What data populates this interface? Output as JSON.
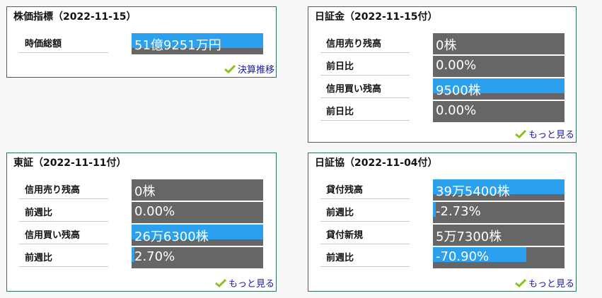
{
  "panels": [
    {
      "title": "株価指標（2022-11-15）",
      "link": "決算推移",
      "rows": [
        {
          "label": "時価総額",
          "value": "51億9251万円",
          "bar": 1.0
        }
      ]
    },
    {
      "title": "日証金（2022-11-15付）",
      "link": "もっと見る",
      "rows": [
        {
          "label": "信用売り残高",
          "value": "0株",
          "bar": 0
        },
        {
          "label": "前日比",
          "value": "0.00%",
          "bar": 0
        },
        {
          "label": "信用買い残高",
          "value": "9500株",
          "bar": 1.0
        },
        {
          "label": "前日比",
          "value": "0.00%",
          "bar": 0
        }
      ]
    },
    {
      "title": "東証（2022-11-11付）",
      "link": "もっと見る",
      "rows": [
        {
          "label": "信用売り残高",
          "value": "0株",
          "bar": 0
        },
        {
          "label": "前週比",
          "value": "0.00%",
          "bar": 0
        },
        {
          "label": "信用買い残高",
          "value": "26万6300株",
          "bar": 1.0
        },
        {
          "label": "前週比",
          "value": "2.70%",
          "bar": 0.027
        }
      ]
    },
    {
      "title": "日証協（2022-11-04付）",
      "link": "もっと見る",
      "rows": [
        {
          "label": "貸付残高",
          "value": "39万5400株",
          "bar": 1.0
        },
        {
          "label": "前週比",
          "value": "-2.73%",
          "bar": 0.0273
        },
        {
          "label": "貸付新規",
          "value": "5万7300株",
          "bar": 0
        },
        {
          "label": "前週比",
          "value": "-70.90%",
          "bar": 0.709
        }
      ]
    }
  ],
  "colors": {
    "bar": "#2aa0ee",
    "box": "#666666",
    "border": "#2f6f5f",
    "link": "#1a1aa6",
    "check": "#8ac21a"
  },
  "icons": {
    "link_icon": "check-icon"
  }
}
